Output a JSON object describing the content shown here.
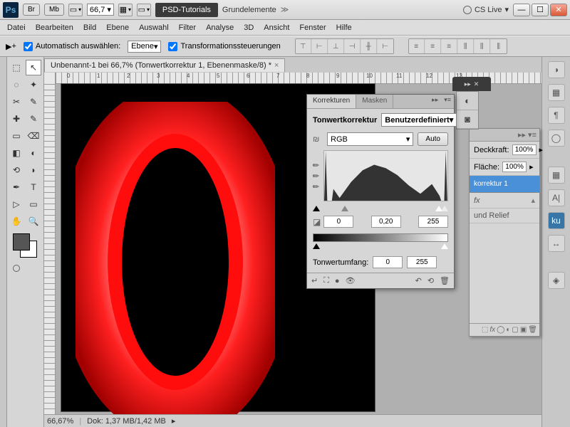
{
  "titlebar": {
    "zoom": "66,7",
    "psd_badge": "PSD-Tutorials",
    "title": "Grundelemente",
    "cslive": "CS Live"
  },
  "menubar": [
    "Datei",
    "Bearbeiten",
    "Bild",
    "Ebene",
    "Auswahl",
    "Filter",
    "Analyse",
    "3D",
    "Ansicht",
    "Fenster",
    "Hilfe"
  ],
  "optbar": {
    "auto_select": "Automatisch auswählen:",
    "auto_select_mode": "Ebene",
    "transform": "Transformationssteuerungen"
  },
  "document": {
    "tab": "Unbenannt-1 bei 66,7% (Tonwertkorrektur 1, Ebenenmaske/8) *",
    "status_zoom": "66,67%",
    "status_doc": "Dok: 1,37 MB/1,42 MB"
  },
  "ruler_marks": [
    "0",
    "1",
    "2",
    "3",
    "4",
    "5",
    "6",
    "7",
    "8",
    "9",
    "10",
    "11",
    "12",
    "13"
  ],
  "korrekturen": {
    "tab1": "Korrekturen",
    "tab2": "Masken",
    "title": "Tonwertkorrektur",
    "preset": "Benutzerdefiniert",
    "channel": "RGB",
    "auto": "Auto",
    "in_black": "0",
    "in_mid": "0,20",
    "in_white": "255",
    "range_label": "Tonwertumfang:",
    "out_black": "0",
    "out_white": "255"
  },
  "layers": {
    "opacity_label": "Deckkraft:",
    "opacity_value": "100%",
    "fill_label": "Fläche:",
    "fill_value": "100%",
    "layer_name": "korrektur 1",
    "effect": "und Relief"
  },
  "tools": [
    [
      "▭",
      "↖"
    ],
    [
      "◌",
      "✦"
    ],
    [
      "✂",
      "✎"
    ],
    [
      "✚",
      "✎"
    ],
    [
      "▭",
      "⌫"
    ],
    [
      "◧",
      "◐"
    ],
    [
      "⟲",
      "✎"
    ],
    [
      "✒",
      "T"
    ],
    [
      "▷",
      "▭"
    ],
    [
      "✋",
      "🔍"
    ]
  ],
  "right_icons": [
    "◑",
    "▦",
    "¶",
    "◯",
    "▦",
    "A|",
    "ku",
    "↔",
    "◈"
  ]
}
